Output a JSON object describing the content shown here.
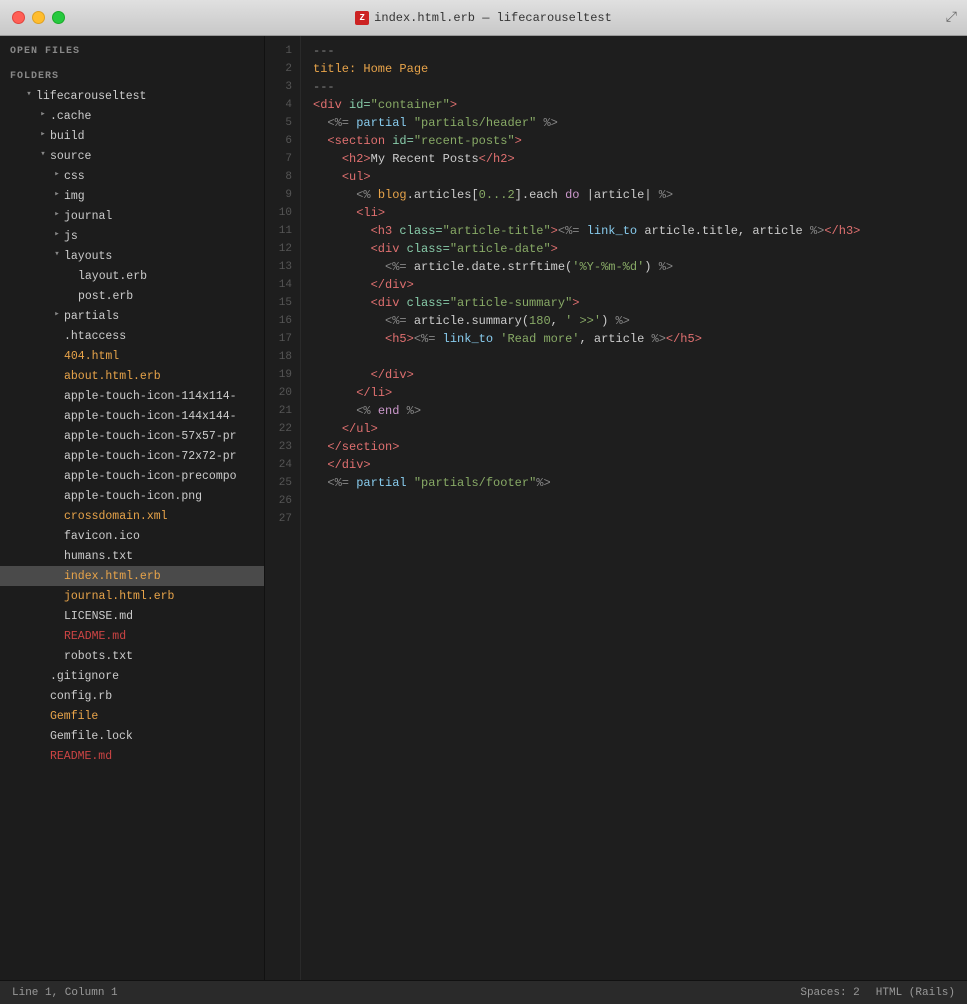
{
  "titlebar": {
    "title": "index.html.erb — lifecarouseltest",
    "icon_label": "Z",
    "buttons": [
      "close",
      "minimize",
      "maximize"
    ]
  },
  "sidebar": {
    "open_files_label": "OPEN FILES",
    "folders_label": "FOLDERS",
    "tree": [
      {
        "id": "lifecarouseltest",
        "label": "lifecarouseltest",
        "indent": 1,
        "arrow": "open",
        "color": ""
      },
      {
        "id": "cache",
        "label": ".cache",
        "indent": 2,
        "arrow": "closed",
        "color": ""
      },
      {
        "id": "build",
        "label": "build",
        "indent": 2,
        "arrow": "closed",
        "color": ""
      },
      {
        "id": "source",
        "label": "source",
        "indent": 2,
        "arrow": "open",
        "color": ""
      },
      {
        "id": "css",
        "label": "css",
        "indent": 3,
        "arrow": "closed",
        "color": ""
      },
      {
        "id": "img",
        "label": "img",
        "indent": 3,
        "arrow": "closed",
        "color": ""
      },
      {
        "id": "journal",
        "label": "journal",
        "indent": 3,
        "arrow": "closed",
        "color": ""
      },
      {
        "id": "js",
        "label": "js",
        "indent": 3,
        "arrow": "closed",
        "color": ""
      },
      {
        "id": "layouts",
        "label": "layouts",
        "indent": 3,
        "arrow": "open",
        "color": ""
      },
      {
        "id": "layout_erb",
        "label": "layout.erb",
        "indent": 4,
        "arrow": "leaf",
        "color": ""
      },
      {
        "id": "post_erb",
        "label": "post.erb",
        "indent": 4,
        "arrow": "leaf",
        "color": ""
      },
      {
        "id": "partials",
        "label": "partials",
        "indent": 3,
        "arrow": "closed",
        "color": ""
      },
      {
        "id": "htaccess",
        "label": ".htaccess",
        "indent": 3,
        "arrow": "leaf",
        "color": ""
      },
      {
        "id": "404",
        "label": "404.html",
        "indent": 3,
        "arrow": "leaf",
        "color": "orange"
      },
      {
        "id": "about",
        "label": "about.html.erb",
        "indent": 3,
        "arrow": "leaf",
        "color": "orange"
      },
      {
        "id": "apple114",
        "label": "apple-touch-icon-114x114-",
        "indent": 3,
        "arrow": "leaf",
        "color": ""
      },
      {
        "id": "apple144",
        "label": "apple-touch-icon-144x144-",
        "indent": 3,
        "arrow": "leaf",
        "color": ""
      },
      {
        "id": "apple57",
        "label": "apple-touch-icon-57x57-pr",
        "indent": 3,
        "arrow": "leaf",
        "color": ""
      },
      {
        "id": "apple72",
        "label": "apple-touch-icon-72x72-pr",
        "indent": 3,
        "arrow": "leaf",
        "color": ""
      },
      {
        "id": "appleprecomp",
        "label": "apple-touch-icon-precompo",
        "indent": 3,
        "arrow": "leaf",
        "color": ""
      },
      {
        "id": "applepng",
        "label": "apple-touch-icon.png",
        "indent": 3,
        "arrow": "leaf",
        "color": ""
      },
      {
        "id": "crossdomain",
        "label": "crossdomain.xml",
        "indent": 3,
        "arrow": "leaf",
        "color": "orange"
      },
      {
        "id": "favicon",
        "label": "favicon.ico",
        "indent": 3,
        "arrow": "leaf",
        "color": ""
      },
      {
        "id": "humans",
        "label": "humans.txt",
        "indent": 3,
        "arrow": "leaf",
        "color": ""
      },
      {
        "id": "index_erb",
        "label": "index.html.erb",
        "indent": 3,
        "arrow": "leaf",
        "color": "orange",
        "active": true
      },
      {
        "id": "journal_erb",
        "label": "journal.html.erb",
        "indent": 3,
        "arrow": "leaf",
        "color": "orange"
      },
      {
        "id": "license",
        "label": "LICENSE.md",
        "indent": 3,
        "arrow": "leaf",
        "color": ""
      },
      {
        "id": "readme_src",
        "label": "README.md",
        "indent": 3,
        "arrow": "leaf",
        "color": "red"
      },
      {
        "id": "robots",
        "label": "robots.txt",
        "indent": 3,
        "arrow": "leaf",
        "color": ""
      },
      {
        "id": "gitignore",
        "label": ".gitignore",
        "indent": 2,
        "arrow": "leaf",
        "color": ""
      },
      {
        "id": "config_rb",
        "label": "config.rb",
        "indent": 2,
        "arrow": "leaf",
        "color": ""
      },
      {
        "id": "gemfile",
        "label": "Gemfile",
        "indent": 2,
        "arrow": "leaf",
        "color": "orange"
      },
      {
        "id": "gemfile_lock",
        "label": "Gemfile.lock",
        "indent": 2,
        "arrow": "leaf",
        "color": ""
      },
      {
        "id": "readme_root",
        "label": "README.md",
        "indent": 2,
        "arrow": "leaf",
        "color": "red"
      }
    ]
  },
  "editor": {
    "filename": "index.html.erb",
    "lines": [
      {
        "num": 1,
        "content_html": "<span class='c-dash'>---</span>"
      },
      {
        "num": 2,
        "content_html": "<span class='c-key'>title: Home Page</span>"
      },
      {
        "num": 3,
        "content_html": "<span class='c-dash'>---</span>"
      },
      {
        "num": 4,
        "content_html": "<span class='c-tag'>&lt;div</span> <span class='c-attr'>id=</span><span class='c-str'>\"container\"</span><span class='c-tag'>&gt;</span>"
      },
      {
        "num": 5,
        "content_html": "  <span class='c-erb'>&lt;%=</span> <span class='c-method'>partial</span> <span class='c-str'>\"partials/header\"</span> <span class='c-erb'>%&gt;</span>"
      },
      {
        "num": 6,
        "content_html": "  <span class='c-tag'>&lt;section</span> <span class='c-attr'>id=</span><span class='c-str'>\"recent-posts\"</span><span class='c-tag'>&gt;</span>"
      },
      {
        "num": 7,
        "content_html": "    <span class='c-tag'>&lt;h2&gt;</span><span class='c-plain'>My Recent Posts</span><span class='c-tag'>&lt;/h2&gt;</span>"
      },
      {
        "num": 8,
        "content_html": "    <span class='c-tag'>&lt;ul&gt;</span>"
      },
      {
        "num": 9,
        "content_html": "      <span class='c-erb'>&lt;%</span> <span class='c-class'>blog</span><span class='c-plain'>.articles[</span><span class='c-str'>0...2</span><span class='c-plain'>].each </span><span class='c-keyword'>do</span> <span class='c-plain'>|article|</span> <span class='c-erb'>%&gt;</span>"
      },
      {
        "num": 10,
        "content_html": "      <span class='c-tag'>&lt;li&gt;</span>"
      },
      {
        "num": 11,
        "content_html": "        <span class='c-tag'>&lt;h3</span> <span class='c-attr'>class=</span><span class='c-str'>\"article-title\"</span><span class='c-tag'>&gt;</span><span class='c-erb'>&lt;%=</span> <span class='c-method'>link_to</span> <span class='c-plain'>article.title, article </span><span class='c-erb'>%&gt;</span><span class='c-tag'>&lt;/h3&gt;</span>"
      },
      {
        "num": 12,
        "content_html": "        <span class='c-tag'>&lt;div</span> <span class='c-attr'>class=</span><span class='c-str'>\"article-date\"</span><span class='c-tag'>&gt;</span>"
      },
      {
        "num": 13,
        "content_html": "          <span class='c-erb'>&lt;%=</span> <span class='c-plain'>article.date.strftime(</span><span class='c-str'>'%Y-%m-%d'</span><span class='c-plain'>) </span><span class='c-erb'>%&gt;</span>"
      },
      {
        "num": 14,
        "content_html": "        <span class='c-tag'>&lt;/div&gt;</span>"
      },
      {
        "num": 15,
        "content_html": "        <span class='c-tag'>&lt;div</span> <span class='c-attr'>class=</span><span class='c-str'>\"article-summary\"</span><span class='c-tag'>&gt;</span>"
      },
      {
        "num": 16,
        "content_html": "          <span class='c-erb'>&lt;%=</span> <span class='c-plain'>article.summary(</span><span class='c-str'>180</span><span class='c-plain'>, </span><span class='c-str'>' &gt;&gt;'</span><span class='c-plain'>) </span><span class='c-erb'>%&gt;</span>"
      },
      {
        "num": 17,
        "content_html": "          <span class='c-tag'>&lt;h5&gt;</span><span class='c-erb'>&lt;%=</span> <span class='c-method'>link_to</span> <span class='c-str'>'Read more'</span><span class='c-plain'>, article </span><span class='c-erb'>%&gt;</span><span class='c-tag'>&lt;/h5&gt;</span>"
      },
      {
        "num": 18,
        "content_html": ""
      },
      {
        "num": 19,
        "content_html": "        <span class='c-tag'>&lt;/div&gt;</span>"
      },
      {
        "num": 20,
        "content_html": "      <span class='c-tag'>&lt;/li&gt;</span>"
      },
      {
        "num": 21,
        "content_html": "      <span class='c-erb'>&lt;%</span> <span class='c-keyword'>end</span> <span class='c-erb'>%&gt;</span>"
      },
      {
        "num": 22,
        "content_html": "    <span class='c-tag'>&lt;/ul&gt;</span>"
      },
      {
        "num": 23,
        "content_html": "  <span class='c-tag'>&lt;/section&gt;</span>"
      },
      {
        "num": 24,
        "content_html": "  <span class='c-tag'>&lt;/div&gt;</span>"
      },
      {
        "num": 25,
        "content_html": "  <span class='c-erb'>&lt;%=</span> <span class='c-method'>partial</span> <span class='c-str'>\"partials/footer\"</span><span class='c-erb'>%&gt;</span>"
      },
      {
        "num": 26,
        "content_html": ""
      },
      {
        "num": 27,
        "content_html": ""
      }
    ]
  },
  "statusbar": {
    "position": "Line 1, Column 1",
    "spaces": "Spaces: 2",
    "syntax": "HTML (Rails)"
  }
}
